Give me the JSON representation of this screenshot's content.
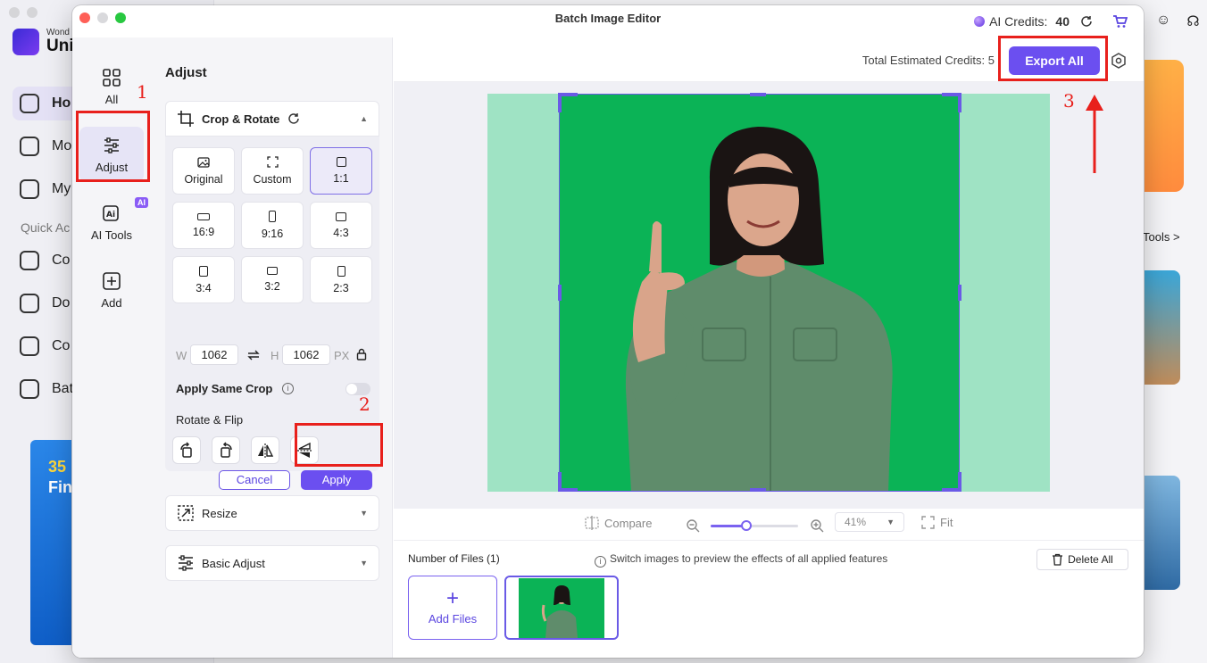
{
  "background_app": {
    "logo_small": "Wond",
    "logo_big": "Uni",
    "nav": [
      "Ho",
      "Mo",
      "My",
      "Co",
      "Do",
      "Co",
      "Bat"
    ],
    "quick_label": "Quick Ac",
    "promo_l1": "35",
    "promo_l2": "Fin",
    "tools_link": "Tools >"
  },
  "window": {
    "title": "Batch Image Editor",
    "ai_credits_label": "AI Credits:",
    "ai_credits_value": "40"
  },
  "left_nav": [
    {
      "label": "All",
      "icon": "grid-icon"
    },
    {
      "label": "Adjust",
      "icon": "sliders-icon"
    },
    {
      "label": "AI Tools",
      "icon": "ai-icon",
      "badge": "AI"
    },
    {
      "label": "Add",
      "icon": "plus-square-icon"
    }
  ],
  "panel": {
    "title": "Adjust",
    "crop_section": {
      "title": "Crop & Rotate",
      "ratios": [
        {
          "label": "Original",
          "active": false
        },
        {
          "label": "Custom",
          "active": false
        },
        {
          "label": "1:1",
          "active": true
        },
        {
          "label": "16:9",
          "active": false
        },
        {
          "label": "9:16",
          "active": false
        },
        {
          "label": "4:3",
          "active": false
        },
        {
          "label": "3:4",
          "active": false
        },
        {
          "label": "3:2",
          "active": false
        },
        {
          "label": "2:3",
          "active": false
        }
      ],
      "width_label": "W",
      "width_value": "1062",
      "height_label": "H",
      "height_value": "1062",
      "unit": "PX",
      "apply_same_crop": "Apply Same Crop",
      "rotate_flip_label": "Rotate & Flip",
      "cancel": "Cancel",
      "apply": "Apply"
    },
    "resize": "Resize",
    "basic_adjust": "Basic Adjust"
  },
  "main": {
    "total_credits_label": "Total Estimated Credits:",
    "total_credits_value": "5",
    "export_all": "Export All",
    "compare": "Compare",
    "zoom": "41%",
    "fit": "Fit",
    "files_count": "Number of Files (1)",
    "files_hint": "Switch images to preview the effects of all applied features",
    "delete_all": "Delete All",
    "add_files": "Add Files"
  },
  "annotations": [
    "1",
    "2",
    "3"
  ],
  "colors": {
    "accent": "#6b4ff0",
    "annotation": "#e8201c",
    "green_screen": "#0bb356"
  }
}
